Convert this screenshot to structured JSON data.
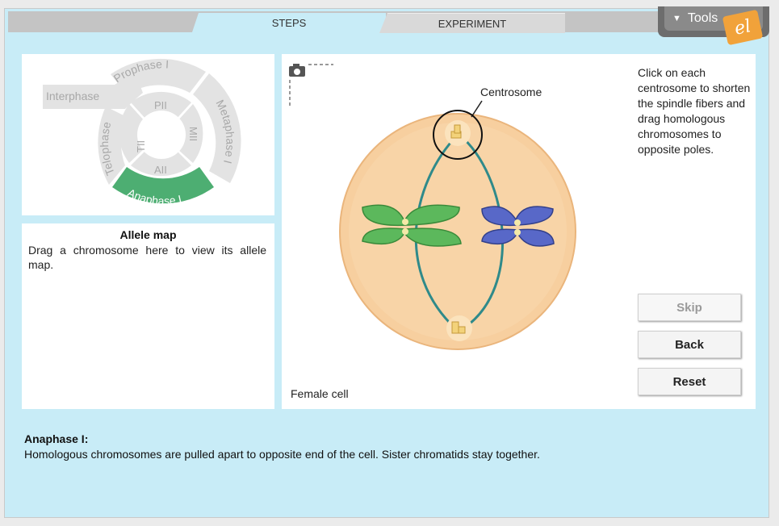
{
  "tabs": {
    "steps": "STEPS",
    "experiment": "EXPERIMENT"
  },
  "tools": {
    "label": "Tools",
    "logo": "el"
  },
  "cycle": {
    "phases": {
      "interphase": "Interphase",
      "prophase1": "Prophase I",
      "metaphase1": "Metaphase I",
      "anaphase1": "Anaphase I",
      "telophase1": "Telophase I",
      "pii": "PII",
      "mii": "MII",
      "aii": "AII",
      "tii": "TII"
    },
    "active_phase": "Anaphase I",
    "colors": {
      "active": "#4dae72",
      "inactive": "#e3e3e3",
      "text": "#a8a8a8"
    }
  },
  "allele": {
    "title": "Allele map",
    "text": "Drag a chromosome here to view its allele map."
  },
  "cell": {
    "centrosome_label": "Centrosome",
    "instructions": "Click on each centrosome to shorten the spindle fibers and drag homologous chromosomes to opposite poles.",
    "cell_label": "Female cell",
    "colors": {
      "cell": "#f7cf9f",
      "spindle": "#2f8a8a",
      "green_chromosome": "#5cb85c",
      "blue_chromosome": "#5868c8"
    }
  },
  "buttons": {
    "skip": "Skip",
    "back": "Back",
    "reset": "Reset"
  },
  "description": {
    "heading": "Anaphase I:",
    "text": "Homologous chromosomes are pulled apart to opposite end of the cell. Sister chromatids stay together."
  }
}
